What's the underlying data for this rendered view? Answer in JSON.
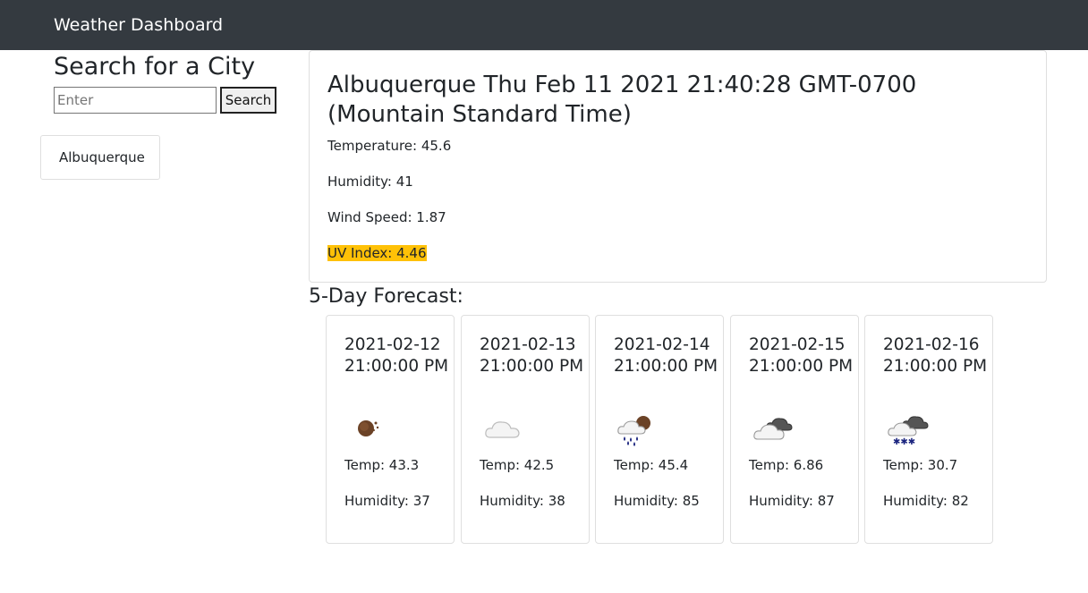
{
  "navbar": {
    "title": "Weather Dashboard"
  },
  "search": {
    "heading": "Search for a City",
    "placeholder": "Enter",
    "button_label": "Search"
  },
  "history": [
    "Albuquerque"
  ],
  "current": {
    "title": "Albuquerque Thu Feb 11 2021 21:40:28 GMT-0700 (Mountain Standard Time)",
    "temperature": "Temperature: 45.6",
    "humidity": "Humidity: 41",
    "wind": "Wind Speed: 1.87",
    "uv": "UV Index: 4.46",
    "uv_color": "#ffc107"
  },
  "forecast": {
    "heading": "5-Day Forecast:",
    "days": [
      {
        "date": "2021-02-12 21:00:00 PM",
        "icon": "clear-night-icon",
        "temp": "Temp: 43.3",
        "humidity": "Humidity: 37"
      },
      {
        "date": "2021-02-13 21:00:00 PM",
        "icon": "cloud-icon",
        "temp": "Temp: 42.5",
        "humidity": "Humidity: 38"
      },
      {
        "date": "2021-02-14 21:00:00 PM",
        "icon": "rain-night-icon",
        "temp": "Temp: 45.4",
        "humidity": "Humidity: 85"
      },
      {
        "date": "2021-02-15 21:00:00 PM",
        "icon": "broken-clouds-icon",
        "temp": "Temp: 6.86",
        "humidity": "Humidity: 87"
      },
      {
        "date": "2021-02-16 21:00:00 PM",
        "icon": "snow-icon",
        "temp": "Temp: 30.7",
        "humidity": "Humidity: 82"
      }
    ]
  }
}
